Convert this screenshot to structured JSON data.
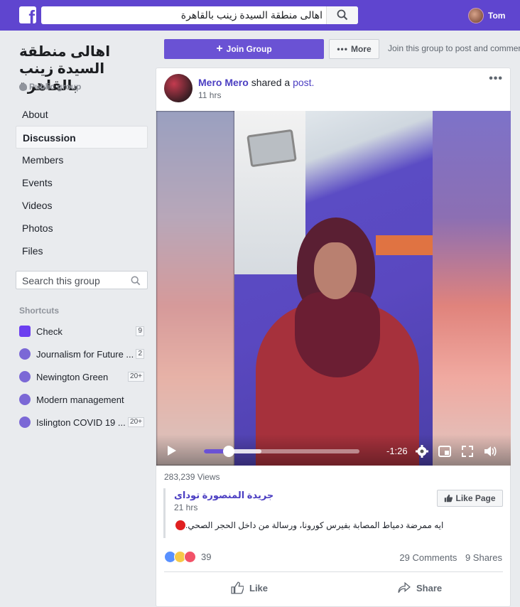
{
  "topbar": {
    "logo": "f",
    "search_value": "اهالى منطقة السيدة زينب بالقاهرة",
    "user_name": "Tom"
  },
  "group": {
    "name": "اهالى منطقة السيدة زينب بالقاهرة",
    "privacy": "Public group"
  },
  "nav": {
    "items": [
      {
        "label": "About"
      },
      {
        "label": "Discussion"
      },
      {
        "label": "Members"
      },
      {
        "label": "Events"
      },
      {
        "label": "Videos"
      },
      {
        "label": "Photos"
      },
      {
        "label": "Files"
      }
    ],
    "active": "Discussion"
  },
  "group_search": {
    "placeholder": "Search this group"
  },
  "shortcuts": {
    "heading": "Shortcuts",
    "items": [
      {
        "label": "Check",
        "badge": "9",
        "icon": "check-app-icon"
      },
      {
        "label": "Journalism for Future ...",
        "badge": "2",
        "icon": "group-icon"
      },
      {
        "label": "Newington Green",
        "badge": "20+",
        "icon": "group-icon"
      },
      {
        "label": "Modern management",
        "badge": "",
        "icon": "group-icon"
      },
      {
        "label": "Islington COVID 19 ...",
        "badge": "20+",
        "icon": "group-icon"
      }
    ]
  },
  "actions": {
    "join_label": "Join Group",
    "more_label": "More",
    "join_hint": "Join this group to post and comment."
  },
  "post": {
    "author": "Mero Mero",
    "verb": "shared a",
    "object": "post.",
    "time": "11 hrs",
    "menu": "•••",
    "video": {
      "time_remaining": "-1:26",
      "progress": 0.16,
      "buffered": 0.37
    },
    "views": "283,239 Views",
    "shared": {
      "page_name": "جريدة المنصورة توداى",
      "time": "21 hrs",
      "like_page_label": "Like Page",
      "text": "ايه ممرضة دمياط المصابة بفيرس كورونا، ورسالة من داخل الحجر الصحي."
    },
    "reactions": {
      "count": "39",
      "types": [
        "like",
        "sad",
        "love"
      ]
    },
    "comments": "29 Comments",
    "shares": "9 Shares",
    "like_label": "Like",
    "share_label": "Share"
  },
  "colors": {
    "topbar": "#5f45cf",
    "accent": "#6a52d4",
    "link": "#4b3ec2"
  }
}
